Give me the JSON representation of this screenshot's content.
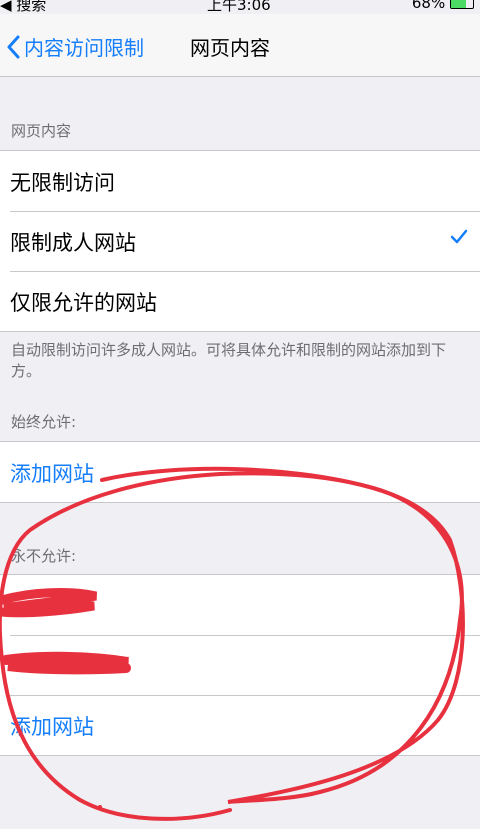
{
  "status_bar": {
    "left": "◀ 搜索",
    "time": "上午3:06",
    "battery": "68%"
  },
  "nav": {
    "back_label": "内容访问限制",
    "title": "网页内容"
  },
  "web_content": {
    "header": "网页内容",
    "options": [
      {
        "label": "无限制访问",
        "selected": false
      },
      {
        "label": "限制成人网站",
        "selected": true
      },
      {
        "label": "仅限允许的网站",
        "selected": false
      }
    ],
    "footer": "自动限制访问许多成人网站。可将具体允许和限制的网站添加到下方。"
  },
  "always_allow": {
    "header": "始终允许:",
    "add_label": "添加网站"
  },
  "never_allow": {
    "header": "永不允许:",
    "add_label": "添加网站"
  },
  "colors": {
    "accent": "#157efb",
    "annotation": "#e8313f"
  }
}
